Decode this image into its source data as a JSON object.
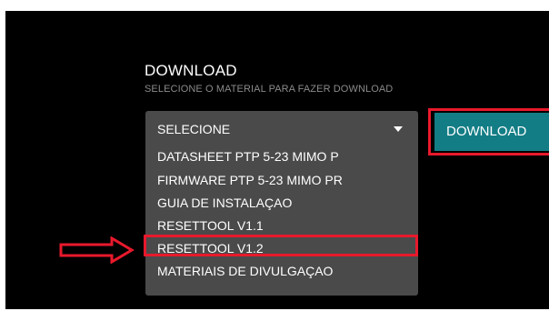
{
  "header": {
    "title": "DOWNLOAD",
    "subtitle": "SELECIONE O MATERIAL PARA FAZER DOWNLOAD"
  },
  "select": {
    "selected": "SELECIONE",
    "options": [
      "DATASHEET PTP 5-23 MIMO P",
      "FIRMWARE PTP 5-23 MIMO PR",
      "GUIA DE INSTALAÇAO",
      "RESETTOOL V1.1",
      "RESETTOOL V1.2",
      "MATERIAIS DE DIVULGAÇAO"
    ],
    "highlighted_option": "RESETTOOL V1.2"
  },
  "button": {
    "label": "DOWNLOAD"
  },
  "annotation": {
    "arrow_icon": "right-arrow-icon",
    "highlight_color": "#e8192c"
  },
  "colors": {
    "button_bg": "#137d85",
    "dropdown_bg": "#4a4a4a",
    "page_bg": "#000000"
  }
}
